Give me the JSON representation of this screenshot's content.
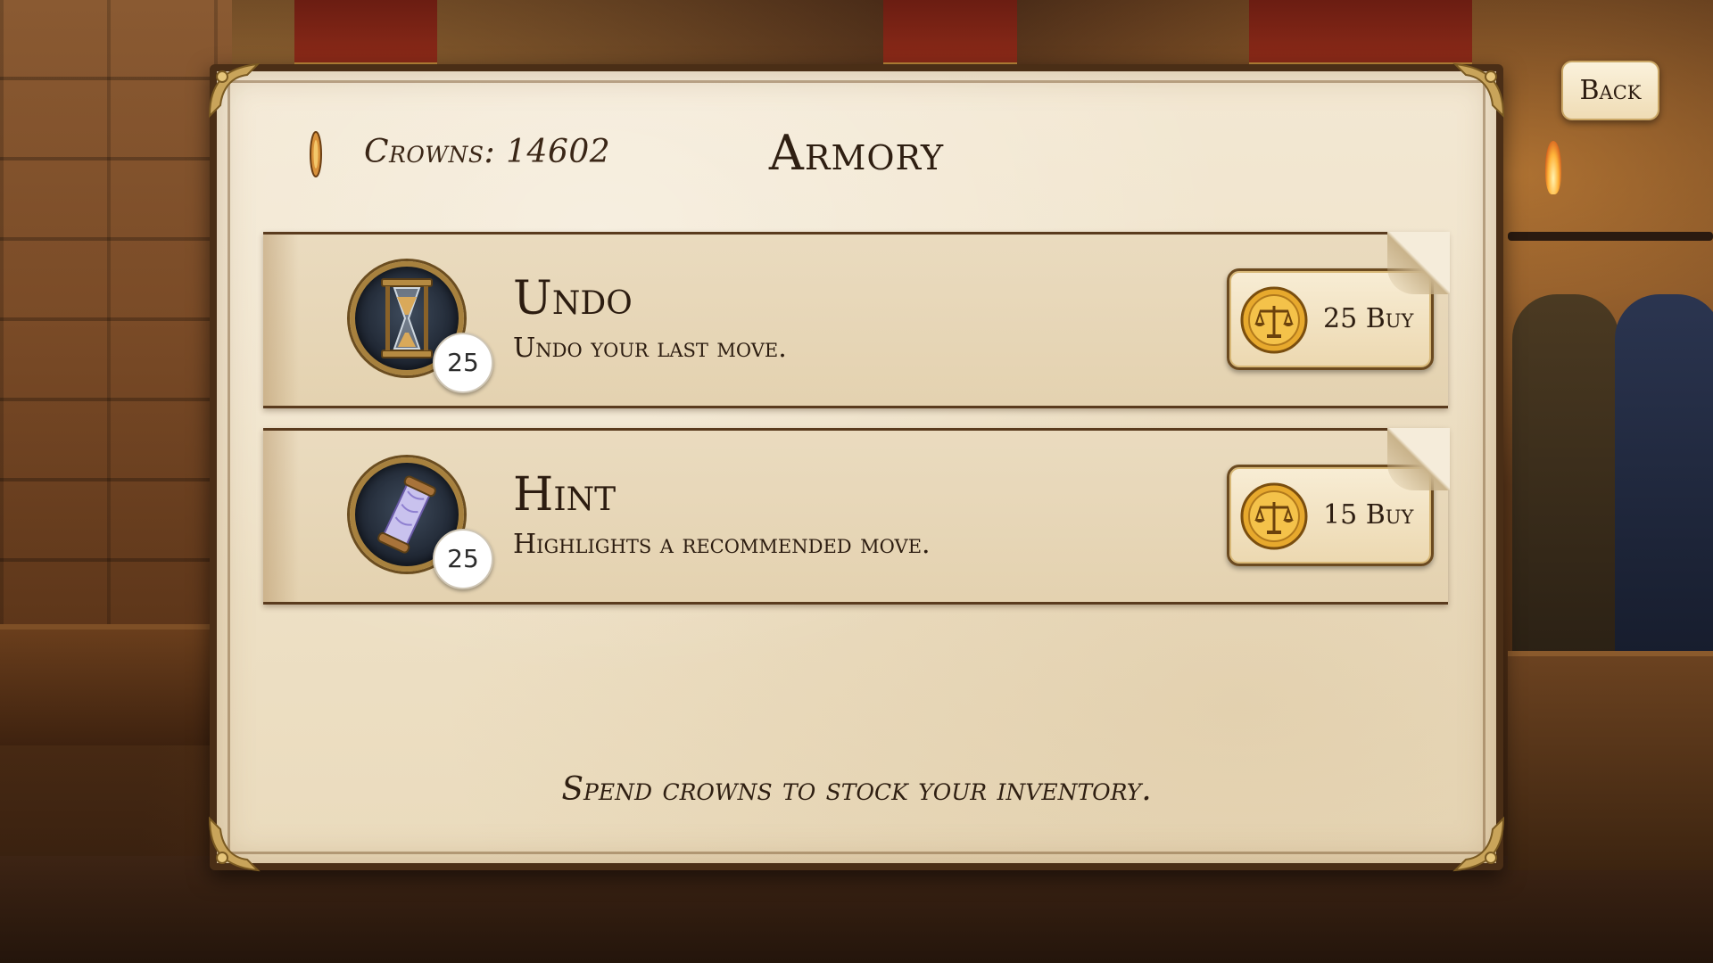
{
  "header": {
    "crowns_label": "Crowns: 14602",
    "title": "Armory",
    "crown_icon": "crown-gem-icon"
  },
  "items": [
    {
      "name": "Undo",
      "description": "Undo your last move.",
      "owned_count": "25",
      "icon": "hourglass-icon",
      "buy_label": "25 Buy",
      "coin_icon": "scales-coin-icon"
    },
    {
      "name": "Hint",
      "description": "Highlights a recommended move.",
      "owned_count": "25",
      "icon": "scroll-icon",
      "buy_label": "15 Buy",
      "coin_icon": "scales-coin-icon"
    }
  ],
  "footer": {
    "note": "Spend crowns to stock your inventory."
  },
  "nav": {
    "back_label": "Back"
  },
  "colors": {
    "parchment": "#efe2c8",
    "frame": "#4a2e16",
    "gold": "#c9a45a",
    "text": "#2c1c10"
  }
}
